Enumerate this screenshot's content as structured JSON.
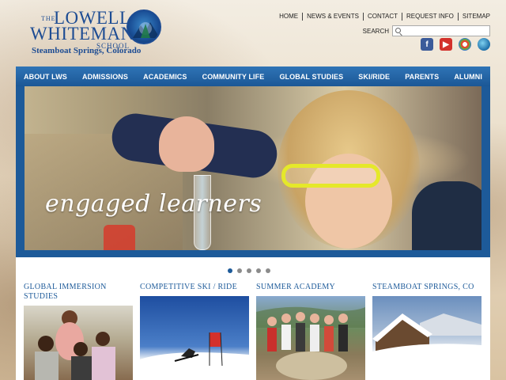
{
  "logo": {
    "the": "THE",
    "line1": "LOWELL",
    "line2": "WHITEMAN",
    "line3": "SCHOOL",
    "tagline": "Steamboat Springs, Colorado"
  },
  "topnav": [
    "HOME",
    "NEWS & EVENTS",
    "CONTACT",
    "REQUEST INFO",
    "SITEMAP"
  ],
  "search": {
    "label": "SEARCH",
    "placeholder": ""
  },
  "social": [
    {
      "icon": "facebook-icon",
      "glyph": "f"
    },
    {
      "icon": "youtube-icon",
      "glyph": "▶"
    },
    {
      "icon": "picasa-icon",
      "glyph": ""
    },
    {
      "icon": "globe-icon",
      "glyph": ""
    }
  ],
  "mainnav": [
    "ABOUT LWS",
    "ADMISSIONS",
    "ACADEMICS",
    "COMMUNITY LIFE",
    "GLOBAL STUDIES",
    "SKI/RIDE",
    "PARENTS",
    "ALUMNI"
  ],
  "hero": {
    "caption": "engaged learners"
  },
  "slider": {
    "count": 5,
    "active": 0
  },
  "features": [
    {
      "title": "GLOBAL IMMERSION STUDIES"
    },
    {
      "title": "COMPETITIVE SKI / RIDE"
    },
    {
      "title": "SUMMER ACADEMY"
    },
    {
      "title": "STEAMBOAT SPRINGS, CO"
    }
  ],
  "colors": {
    "brand_blue": "#1d4c93",
    "nav_blue": "#2f74b6",
    "accent_yellow": "#e5e82a"
  }
}
